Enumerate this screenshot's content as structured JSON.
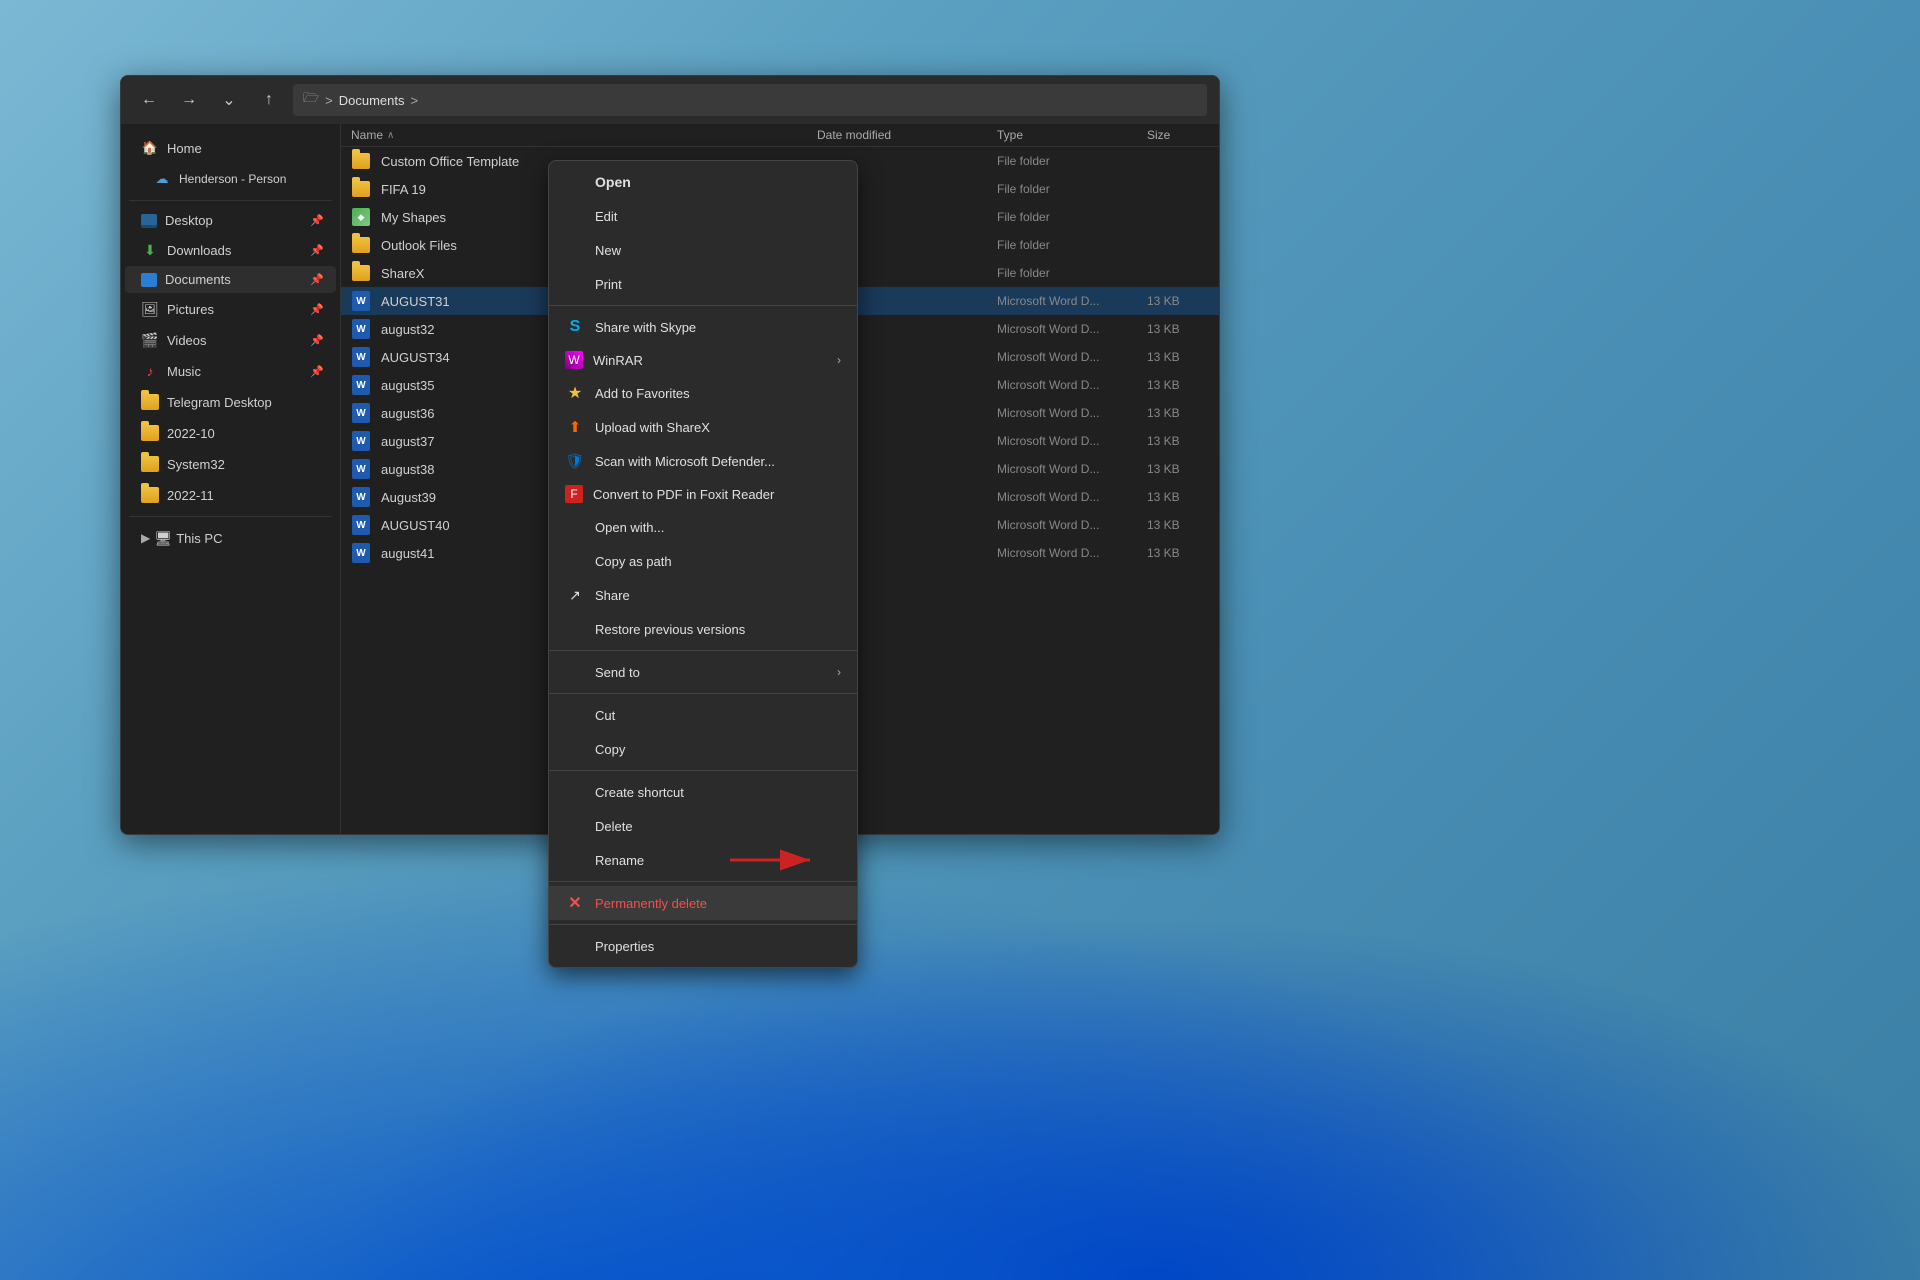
{
  "window": {
    "title": "Documents"
  },
  "titlebar": {
    "back_label": "←",
    "forward_label": "→",
    "dropdown_label": "⌄",
    "up_label": "↑",
    "address": "Documents",
    "address_prefix": "🗁"
  },
  "sidebar": {
    "home_label": "Home",
    "user_label": "Henderson - Person",
    "items": [
      {
        "label": "Desktop",
        "pin": true
      },
      {
        "label": "Downloads",
        "pin": true
      },
      {
        "label": "Documents",
        "pin": true,
        "active": true
      },
      {
        "label": "Pictures",
        "pin": true
      },
      {
        "label": "Videos",
        "pin": true
      },
      {
        "label": "Music",
        "pin": true
      },
      {
        "label": "Telegram Desktop"
      },
      {
        "label": "2022-10"
      },
      {
        "label": "System32"
      },
      {
        "label": "2022-11"
      }
    ],
    "this_pc_label": "This PC"
  },
  "file_list": {
    "columns": {
      "name": "Name",
      "date": "Date modified",
      "type": "Type",
      "size": "Size"
    },
    "folders": [
      {
        "name": "Custom Office Template",
        "type": "File folder"
      },
      {
        "name": "FIFA 19",
        "type": "File folder"
      },
      {
        "name": "My Shapes",
        "type": "File folder"
      },
      {
        "name": "Outlook Files",
        "type": "File folder"
      },
      {
        "name": "ShareX",
        "type": "File folder"
      }
    ],
    "files": [
      {
        "name": "AUGUST31",
        "type": "Microsoft Word D...",
        "size": "13 KB",
        "selected": true
      },
      {
        "name": "august32",
        "type": "Microsoft Word D...",
        "size": "13 KB"
      },
      {
        "name": "AUGUST34",
        "type": "Microsoft Word D...",
        "size": "13 KB"
      },
      {
        "name": "august35",
        "type": "Microsoft Word D...",
        "size": "13 KB"
      },
      {
        "name": "august36",
        "type": "Microsoft Word D...",
        "size": "13 KB"
      },
      {
        "name": "august37",
        "type": "Microsoft Word D...",
        "size": "13 KB"
      },
      {
        "name": "august38",
        "type": "Microsoft Word D...",
        "size": "13 KB"
      },
      {
        "name": "August39",
        "type": "Microsoft Word D...",
        "size": "13 KB"
      },
      {
        "name": "AUGUST40",
        "type": "Microsoft Word D...",
        "size": "13 KB"
      },
      {
        "name": "august41",
        "type": "Microsoft Word D...",
        "size": "13 KB"
      }
    ]
  },
  "context_menu": {
    "items": [
      {
        "id": "open",
        "label": "Open",
        "bold": true,
        "icon": ""
      },
      {
        "id": "edit",
        "label": "Edit",
        "icon": ""
      },
      {
        "id": "new",
        "label": "New",
        "icon": ""
      },
      {
        "id": "print",
        "label": "Print",
        "icon": ""
      },
      {
        "id": "separator1"
      },
      {
        "id": "share-skype",
        "label": "Share with Skype",
        "icon": "skype",
        "icon_char": "S"
      },
      {
        "id": "winrar",
        "label": "WinRAR",
        "icon": "winrar",
        "has_arrow": true
      },
      {
        "id": "add-favorites",
        "label": "Add to Favorites",
        "icon": "star"
      },
      {
        "id": "upload-sharex",
        "label": "Upload with ShareX",
        "icon": "sharex"
      },
      {
        "id": "scan-defender",
        "label": "Scan with Microsoft Defender...",
        "icon": "defender"
      },
      {
        "id": "convert-pdf",
        "label": "Convert to PDF in Foxit Reader",
        "icon": "foxit"
      },
      {
        "id": "open-with",
        "label": "Open with...",
        "icon": ""
      },
      {
        "id": "copy-path",
        "label": "Copy as path",
        "icon": ""
      },
      {
        "id": "share",
        "label": "Share",
        "icon": "share"
      },
      {
        "id": "restore",
        "label": "Restore previous versions",
        "icon": ""
      },
      {
        "id": "separator2"
      },
      {
        "id": "send-to",
        "label": "Send to",
        "has_arrow": true
      },
      {
        "id": "separator3"
      },
      {
        "id": "cut",
        "label": "Cut"
      },
      {
        "id": "copy",
        "label": "Copy"
      },
      {
        "id": "separator4"
      },
      {
        "id": "create-shortcut",
        "label": "Create shortcut"
      },
      {
        "id": "delete",
        "label": "Delete"
      },
      {
        "id": "rename",
        "label": "Rename"
      },
      {
        "id": "separator5"
      },
      {
        "id": "perm-delete",
        "label": "Permanently delete",
        "red": true,
        "icon": "x-red"
      },
      {
        "id": "separator6"
      },
      {
        "id": "properties",
        "label": "Properties"
      }
    ]
  },
  "arrow": {
    "text": "→ points to Permanently delete"
  }
}
